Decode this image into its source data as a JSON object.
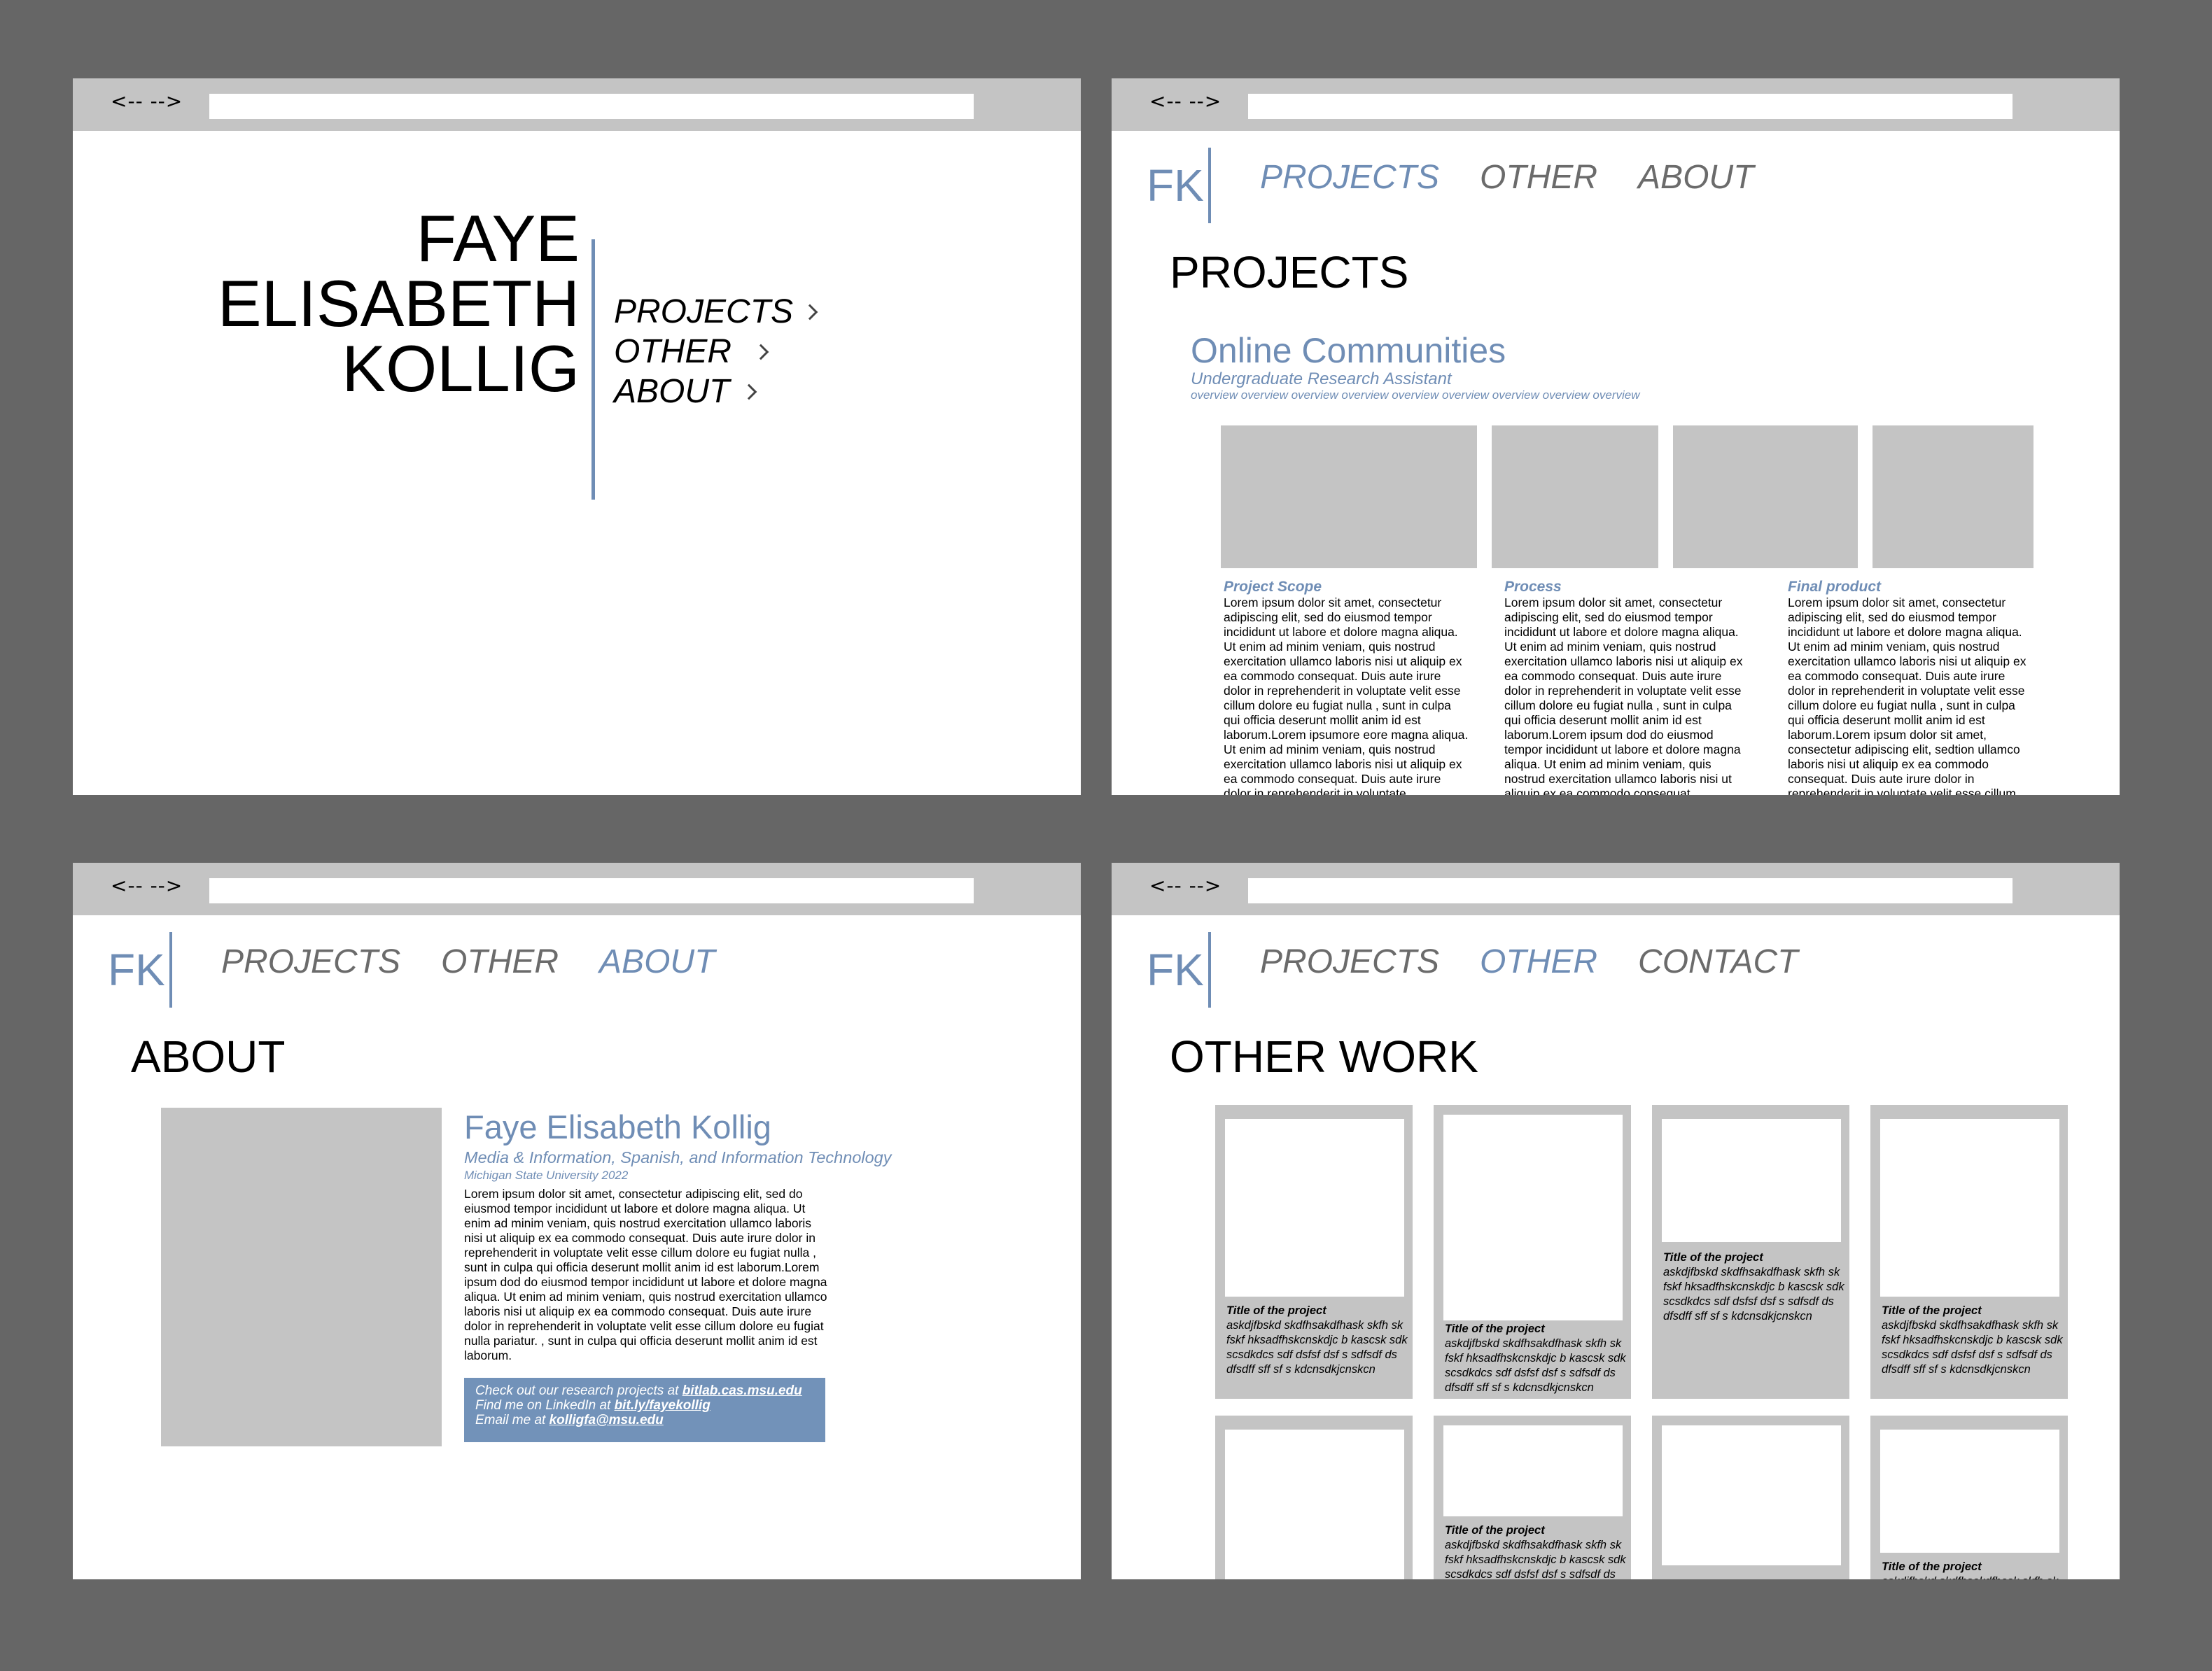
{
  "browser": {
    "nav_arrows": "<--  -->"
  },
  "landing": {
    "name_lines": [
      "FAYE",
      "ELISABETH",
      "KOLLIG"
    ],
    "nav": [
      "PROJECTS",
      "OTHER",
      "ABOUT"
    ]
  },
  "projects_page": {
    "logo": "FK",
    "nav": [
      "PROJECTS",
      "OTHER",
      "ABOUT"
    ],
    "page_title": "PROJECTS",
    "project": {
      "title": "Online Communities",
      "role": "Undergraduate Research Assistant",
      "overview": "overview overview overview overview overview overview overview overview overview"
    },
    "columns": [
      {
        "heading": "Project Scope",
        "text": "Lorem ipsum dolor sit amet, consectetur adipiscing elit, sed do eiusmod tempor incididunt ut labore et dolore magna aliqua. Ut enim ad minim veniam, quis nostrud exercitation ullamco laboris nisi ut aliquip ex ea commodo consequat. Duis aute irure dolor in reprehenderit in voluptate velit esse cillum dolore eu fugiat nulla , sunt in culpa qui officia deserunt mollit anim id est laborum.Lorem ipsumore eore magna aliqua. Ut enim ad minim veniam, quis nostrud exercitation ullamco laboris nisi ut aliquip ex ea commodo consequat. Duis aute irure dolor in reprehenderit in voluptate"
      },
      {
        "heading": "Process",
        "text": "Lorem ipsum dolor sit amet, consectetur adipiscing elit, sed do eiusmod tempor incididunt ut labore et dolore magna aliqua. Ut enim ad minim veniam, quis nostrud exercitation ullamco laboris nisi ut aliquip ex ea commodo consequat. Duis aute irure dolor in reprehenderit in voluptate velit esse cillum dolore eu fugiat nulla , sunt in culpa qui officia deserunt mollit anim id est laborum.Lorem ipsum dod do eiusmod tempor incididunt ut labore et dolore magna aliqua. Ut enim ad minim veniam, quis nostrud exercitation ullamco laboris nisi ut aliquip ex ea commodo consequat."
      },
      {
        "heading": "Final product",
        "text": "Lorem ipsum dolor sit amet, consectetur adipiscing elit, sed do eiusmod tempor incididunt ut labore et dolore magna aliqua. Ut enim ad minim veniam, quis nostrud exercitation ullamco laboris nisi ut aliquip ex ea commodo consequat. Duis aute irure dolor in reprehenderit in voluptate velit esse cillum dolore eu fugiat nulla , sunt in culpa qui officia deserunt mollit anim id est laborum.Lorem ipsum dolor sit amet, consectetur adipiscing elit, sedtion ullamco laboris nisi ut aliquip ex ea commodo consequat. Duis aute irure dolor in reprehenderit in voluptate velit esse cillum"
      }
    ]
  },
  "about_page": {
    "logo": "FK",
    "nav": [
      "PROJECTS",
      "OTHER",
      "ABOUT"
    ],
    "page_title": "ABOUT",
    "name": "Faye Elisabeth Kollig",
    "major": "Media & Information, Spanish, and Information Technology",
    "school": "Michigan State University 2022",
    "bio": "Lorem ipsum dolor sit amet, consectetur adipiscing elit, sed do eiusmod tempor incididunt ut labore et dolore magna aliqua. Ut enim ad minim veniam, quis nostrud exercitation ullamco laboris nisi ut aliquip ex ea commodo consequat. Duis aute irure dolor in reprehenderit in voluptate velit esse cillum dolore eu fugiat nulla , sunt in culpa qui officia deserunt mollit anim id est laborum.Lorem ipsum dod do eiusmod tempor incididunt ut labore et dolore magna aliqua. Ut enim ad minim veniam, quis nostrud exercitation ullamco laboris nisi ut aliquip ex ea commodo consequat. Duis aute irure dolor in reprehenderit in voluptate velit esse cillum dolore eu fugiat nulla pariatur. , sunt in culpa qui officia deserunt mollit anim id est laborum.",
    "contact": {
      "research_prefix": "Check out our research projects at ",
      "research_link": "bitlab.cas.msu.edu",
      "linkedin_prefix": "Find me on LinkedIn at ",
      "linkedin_link": "bit.ly/fayekollig",
      "email_prefix": "Email me at ",
      "email_link": "kolligfa@msu.edu"
    }
  },
  "other_page": {
    "logo": "FK",
    "nav": [
      "PROJECTS",
      "OTHER",
      "CONTACT"
    ],
    "page_title": "OTHER WORK",
    "card_title": "Title of the project",
    "card_desc": "askdjfbskd skdfhsakdfhask skfh sk fskf hksadfhskcnskdjc b kascsk sdk scsdkdcs sdf dsfsf dsf s sdfsdf ds dfsdff sff sf s kdcnsdkjcnskcn"
  }
}
